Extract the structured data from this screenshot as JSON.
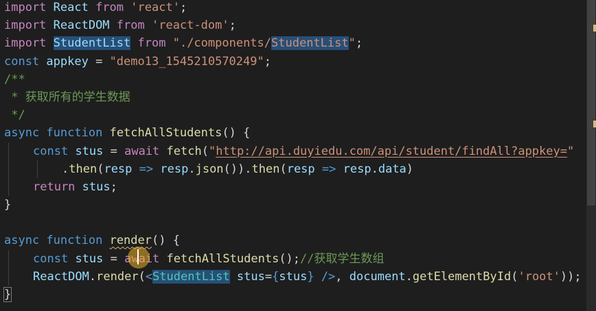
{
  "editor": {
    "language": "javascript",
    "lines": [
      {
        "indent": 0,
        "tokens": [
          {
            "t": "import",
            "c": "ctl"
          },
          {
            "t": " React ",
            "c": "var"
          },
          {
            "t": "from",
            "c": "ctl"
          },
          {
            "t": " "
          },
          {
            "t": "'react'",
            "c": "str"
          },
          {
            "t": ";"
          }
        ]
      },
      {
        "indent": 0,
        "tokens": [
          {
            "t": "import",
            "c": "ctl"
          },
          {
            "t": " ReactDOM ",
            "c": "var"
          },
          {
            "t": "from",
            "c": "ctl"
          },
          {
            "t": " "
          },
          {
            "t": "'react-dom'",
            "c": "str"
          },
          {
            "t": ";"
          }
        ]
      },
      {
        "indent": 0,
        "tokens": [
          {
            "t": "import",
            "c": "ctl"
          },
          {
            "t": " "
          },
          {
            "t": "StudentList",
            "c": "var hl"
          },
          {
            "t": " "
          },
          {
            "t": "from",
            "c": "ctl"
          },
          {
            "t": " "
          },
          {
            "t": "\"./components/",
            "c": "str"
          },
          {
            "t": "StudentList",
            "c": "str hl"
          },
          {
            "t": "\"",
            "c": "str"
          },
          {
            "t": ";"
          }
        ]
      },
      {
        "indent": 0,
        "tokens": [
          {
            "t": "const",
            "c": "kw"
          },
          {
            "t": " appkey ",
            "c": "var"
          },
          {
            "t": "= "
          },
          {
            "t": "\"demo13_1545210570249\"",
            "c": "str"
          },
          {
            "t": ";"
          }
        ]
      },
      {
        "indent": 0,
        "tokens": [
          {
            "t": "/**",
            "c": "cm"
          }
        ]
      },
      {
        "indent": 0,
        "tokens": [
          {
            "t": " * 获取所有的学生数据",
            "c": "cm"
          }
        ]
      },
      {
        "indent": 0,
        "tokens": [
          {
            "t": " */",
            "c": "cm"
          }
        ]
      },
      {
        "indent": 0,
        "tokens": [
          {
            "t": "async",
            "c": "kw"
          },
          {
            "t": " "
          },
          {
            "t": "function",
            "c": "kw"
          },
          {
            "t": " "
          },
          {
            "t": "fetchAllStudents",
            "c": "fn"
          },
          {
            "t": "() {"
          }
        ]
      },
      {
        "indent": 1,
        "tokens": [
          {
            "t": "const",
            "c": "kw"
          },
          {
            "t": " "
          },
          {
            "t": "stus",
            "c": "var"
          },
          {
            "t": " = "
          },
          {
            "t": "await",
            "c": "ctl"
          },
          {
            "t": " "
          },
          {
            "t": "fetch",
            "c": "fn"
          },
          {
            "t": "("
          },
          {
            "t": "\"",
            "c": "str"
          },
          {
            "t": "http://api.duyiedu.com/api/student/findAll?appkey=",
            "c": "str link"
          },
          {
            "t": "\"",
            "c": "str"
          }
        ]
      },
      {
        "indent": 2,
        "tokens": [
          {
            "t": "."
          },
          {
            "t": "then",
            "c": "fn"
          },
          {
            "t": "("
          },
          {
            "t": "resp",
            "c": "var"
          },
          {
            "t": " "
          },
          {
            "t": "=>",
            "c": "kw"
          },
          {
            "t": " "
          },
          {
            "t": "resp",
            "c": "var"
          },
          {
            "t": "."
          },
          {
            "t": "json",
            "c": "fn"
          },
          {
            "t": "())."
          },
          {
            "t": "then",
            "c": "fn"
          },
          {
            "t": "("
          },
          {
            "t": "resp",
            "c": "var"
          },
          {
            "t": " "
          },
          {
            "t": "=>",
            "c": "kw"
          },
          {
            "t": " "
          },
          {
            "t": "resp",
            "c": "var"
          },
          {
            "t": "."
          },
          {
            "t": "data",
            "c": "var"
          },
          {
            "t": ")"
          }
        ]
      },
      {
        "indent": 1,
        "tokens": [
          {
            "t": "return",
            "c": "ctl"
          },
          {
            "t": " "
          },
          {
            "t": "stus",
            "c": "var"
          },
          {
            "t": ";"
          }
        ]
      },
      {
        "indent": 0,
        "tokens": [
          {
            "t": "}"
          }
        ]
      },
      {
        "indent": 0,
        "tokens": []
      },
      {
        "indent": 0,
        "tokens": [
          {
            "t": "async",
            "c": "kw"
          },
          {
            "t": " "
          },
          {
            "t": "function",
            "c": "kw"
          },
          {
            "t": " "
          },
          {
            "t": "render",
            "c": "fn squig"
          },
          {
            "t": "() {"
          }
        ]
      },
      {
        "indent": 1,
        "tokens": [
          {
            "t": "const",
            "c": "kw"
          },
          {
            "t": " "
          },
          {
            "t": "stus",
            "c": "var"
          },
          {
            "t": " = "
          },
          {
            "t": "await",
            "c": "ctl"
          },
          {
            "t": " "
          },
          {
            "t": "fetchAllStudents",
            "c": "fn"
          },
          {
            "t": "();"
          },
          {
            "t": "//获取学生数组",
            "c": "cm"
          }
        ]
      },
      {
        "indent": 1,
        "tokens": [
          {
            "t": "ReactDOM",
            "c": "var"
          },
          {
            "t": "."
          },
          {
            "t": "render",
            "c": "fn"
          },
          {
            "t": "("
          },
          {
            "t": "<",
            "c": "kw"
          },
          {
            "t": "StudentList",
            "c": "cls hl"
          },
          {
            "t": " "
          },
          {
            "t": "stus",
            "c": "var"
          },
          {
            "t": "="
          },
          {
            "t": "{",
            "c": "kw"
          },
          {
            "t": "stus",
            "c": "var"
          },
          {
            "t": "}",
            "c": "kw"
          },
          {
            "t": " "
          },
          {
            "t": "/>",
            "c": "kw"
          },
          {
            "t": ", "
          },
          {
            "t": "document",
            "c": "var"
          },
          {
            "t": "."
          },
          {
            "t": "getElementById",
            "c": "fn"
          },
          {
            "t": "("
          },
          {
            "t": "'root'",
            "c": "str"
          },
          {
            "t": "));"
          }
        ]
      },
      {
        "indent": 0,
        "tokens": [
          {
            "t": "}",
            "c": "bracket-hl"
          }
        ]
      }
    ]
  },
  "colors": {
    "background": "#1e1e1e",
    "keyword": "#569cd6",
    "control": "#c586c0",
    "function": "#dcdcaa",
    "variable": "#9cdcfe",
    "string": "#ce9178",
    "comment": "#6a9955",
    "class": "#4ec9b0",
    "selection_highlight": "#264f78"
  }
}
